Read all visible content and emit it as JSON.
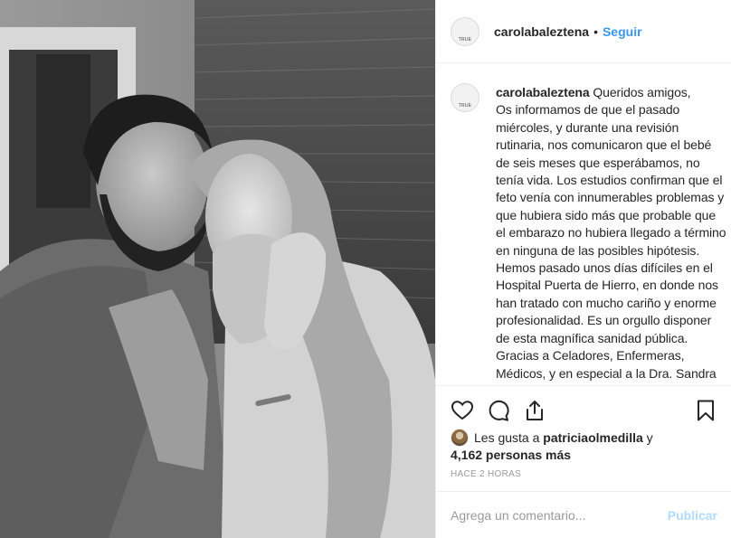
{
  "post": {
    "username": "carolabaleztena",
    "avatar_text": "TRUE",
    "follow_label": "Seguir",
    "separator": "•",
    "caption": {
      "username": "carolabaleztena",
      "text": " Queridos amigos,\nOs informamos de que el pasado miércoles, y durante una revisión rutinaria, nos comunicaron que el bebé de seis meses que esperábamos, no tenía vida. Los estudios confirman que el feto venía con innumerables problemas y que hubiera sido más que probable que el embarazo no hubiera llegado a término en ninguna de las posibles hipótesis.\nHemos pasado unos días difíciles en el Hospital Puerta de Hierro, en donde nos han tratado con mucho cariño y enorme profesionalidad. Es un orgullo disponer de esta magnífica sanidad pública. Gracias a Celadores, Enfermeras, Médicos, y en especial a la Dra. Sandra Arranz, que han hecho"
    },
    "likes": {
      "prefix": "Les gusta a ",
      "liker": "patriciaolmedilla",
      "middle": " y",
      "count_text": "4,162 personas más"
    },
    "timestamp": "Hace 2 horas",
    "comment": {
      "placeholder": "Agrega un comentario...",
      "publish_label": "Publicar"
    }
  },
  "icons": {
    "like": "heart-icon",
    "comment": "comment-bubble-icon",
    "share": "share-icon",
    "save": "bookmark-icon"
  },
  "colors": {
    "link_blue": "#3897f0",
    "publish_disabled": "#b3dbff",
    "border": "#efefef",
    "muted_text": "#999999"
  }
}
